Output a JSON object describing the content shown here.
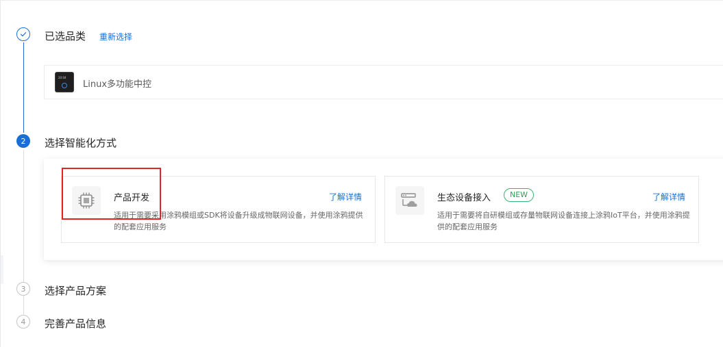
{
  "steps": [
    {
      "number": "1",
      "title": "已选品类",
      "state": "done"
    },
    {
      "number": "2",
      "title": "选择智能化方式",
      "state": "active"
    },
    {
      "number": "3",
      "title": "选择产品方案",
      "state": "pending"
    },
    {
      "number": "4",
      "title": "完善产品信息",
      "state": "pending"
    }
  ],
  "reselect_label": "重新选择",
  "selected_category": {
    "name": "Linux多功能中控",
    "thumb_time": "20:04"
  },
  "options": [
    {
      "title": "产品开发",
      "link": "了解详情",
      "description": "适用于需要采用涂鸦模组或SDK将设备升级成物联网设备，并使用涂鸦提供的配套应用服务",
      "icon": "chip-icon"
    },
    {
      "title": "生态设备接入",
      "badge": "NEW",
      "link": "了解详情",
      "description": "适用于需要将自研模组或存量物联网设备连接上涂鸦IoT平台，并使用涂鸦提供的配套应用服务",
      "icon": "cloud-device-icon"
    }
  ],
  "colors": {
    "primary": "#1a6fd6",
    "badge_green": "#2e9e5b",
    "highlight_red": "#e02424"
  }
}
